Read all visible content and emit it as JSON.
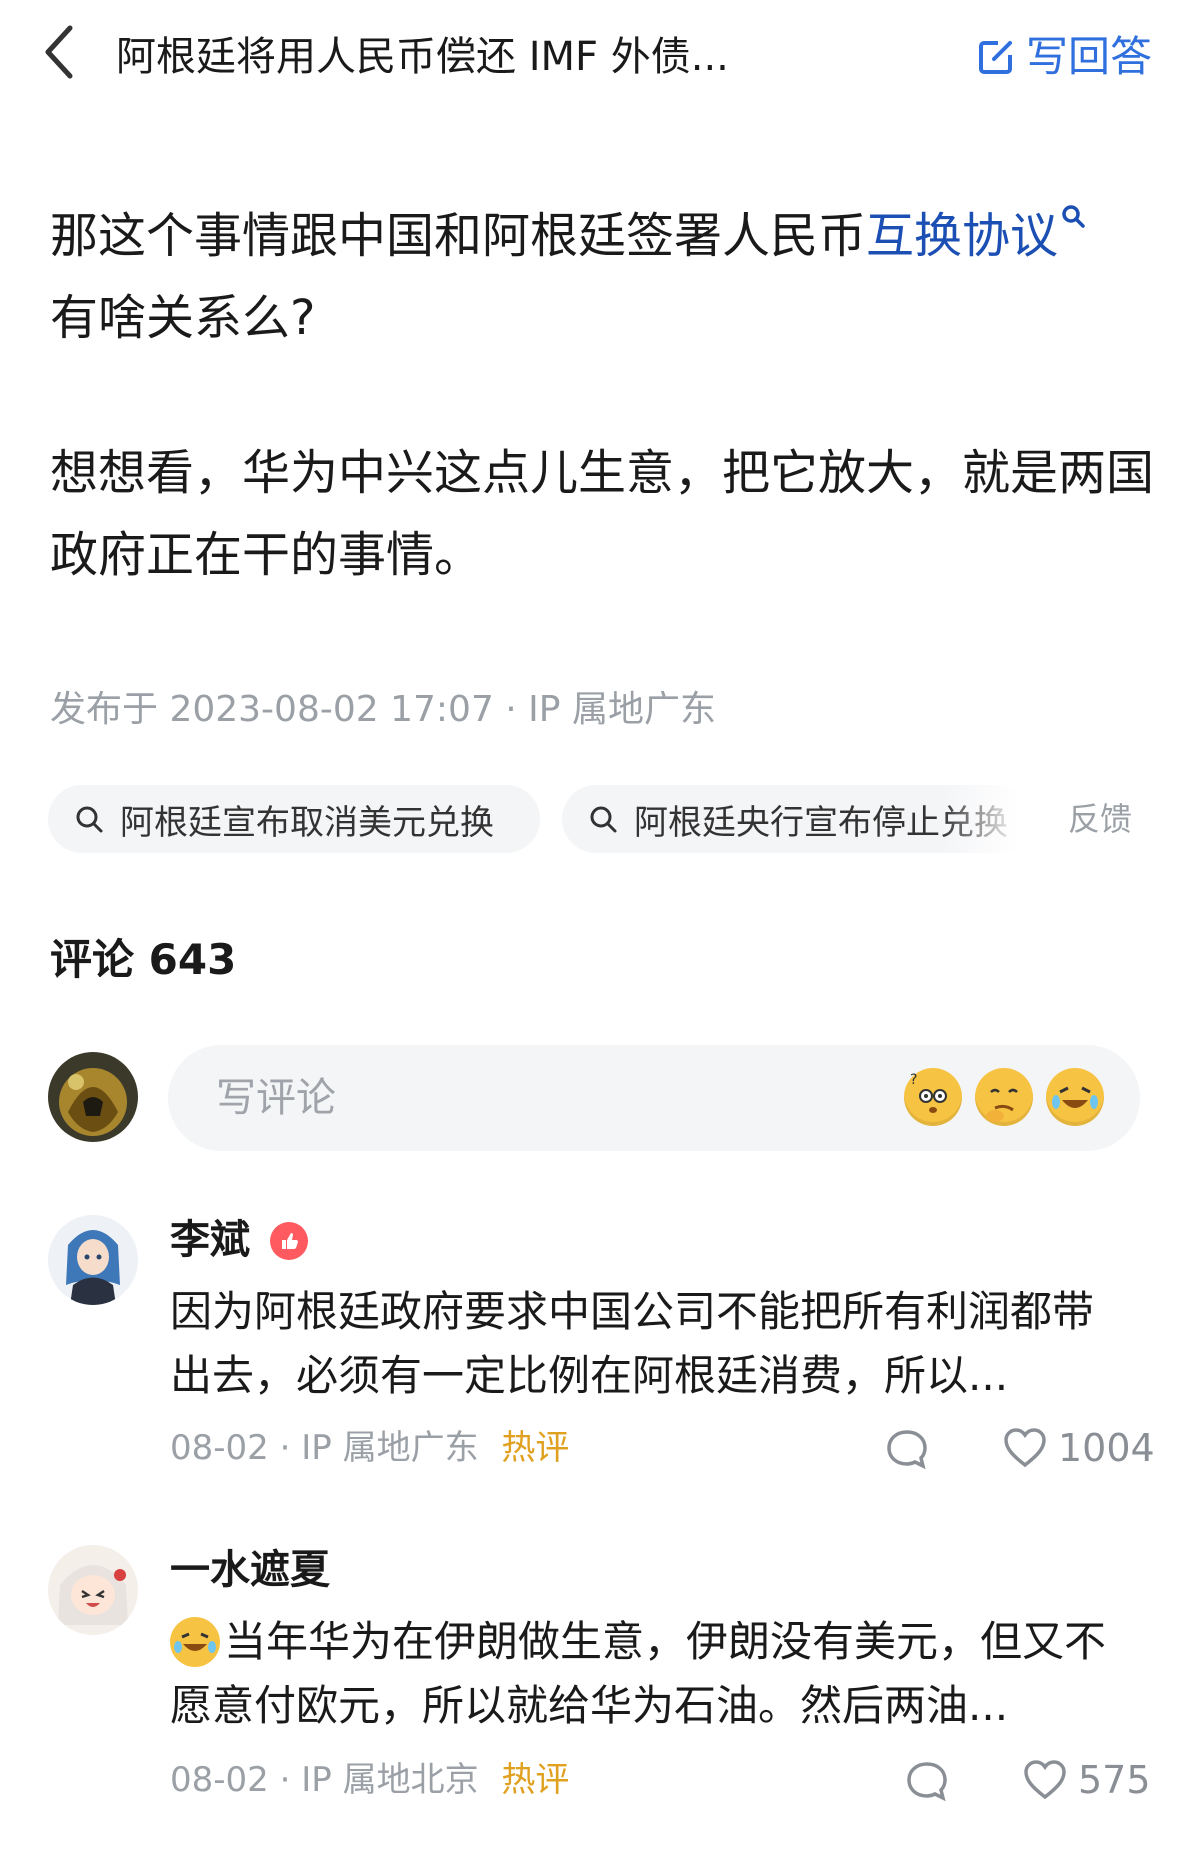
{
  "header": {
    "title": "阿根廷将用人民币偿还 IMF 外债...",
    "write_answer": "写回答"
  },
  "content": {
    "p1_before": "那这个事情跟中国和阿根廷签署人民币",
    "p1_link": "互换协议",
    "p1_after": "有啥关系么?",
    "p2": "想想看，华为中兴这点儿生意，把它放大，就是两国政府正在干的事情。",
    "meta": "发布于 2023-08-02 17:07 · IP 属地广东"
  },
  "related": {
    "chips": [
      "阿根廷宣布取消美元兑换",
      "阿根廷央行宣布停止兑换"
    ],
    "feedback": "反馈"
  },
  "comments_header": {
    "label": "评论 643"
  },
  "comment_input": {
    "placeholder": "写评论"
  },
  "comments": [
    {
      "name": "李斌",
      "text": "因为阿根廷政府要求中国公司不能把所有利润都带出去，必须有一定比例在阿根廷消费，所以...",
      "date": "08-02",
      "ip": "IP 属地广东",
      "tag": "热评",
      "likes": "1004"
    },
    {
      "name": "一水遮夏",
      "text": "当年华为在伊朗做生意，伊朗没有美元，但又不愿意付欧元，所以就给华为石油。然后两油...",
      "date": "08-02",
      "ip": "IP 属地北京",
      "tag": "热评",
      "likes": "575"
    }
  ],
  "colors": {
    "accent": "#2f6fde",
    "link": "#1c4fb3",
    "hot": "#e0a020",
    "muted": "#9aa0a6"
  }
}
